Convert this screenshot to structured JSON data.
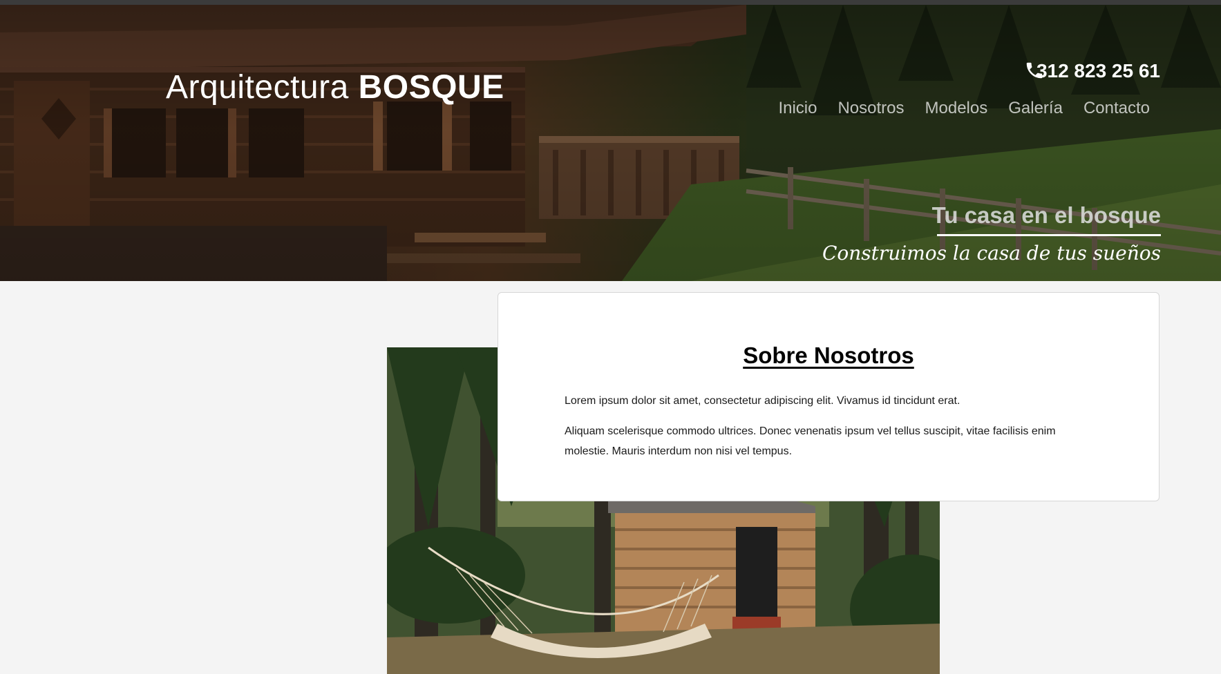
{
  "brand": {
    "name_light": "Arquitectura",
    "name_bold": "BOSQUE"
  },
  "header": {
    "phone": "312 823 25 61",
    "phone_icon": "phone-icon"
  },
  "nav": {
    "items": [
      {
        "label": "Inicio"
      },
      {
        "label": "Nosotros"
      },
      {
        "label": "Modelos"
      },
      {
        "label": "Galería"
      },
      {
        "label": "Contacto"
      }
    ]
  },
  "hero": {
    "title": "Tu casa en el bosque",
    "subtitle": "Construimos la casa de tus sueños"
  },
  "about": {
    "title": "Sobre Nosotros",
    "paragraphs": [
      "Lorem ipsum dolor sit amet, consectetur adipiscing elit. Vivamus id tincidunt erat.",
      "Aliquam scelerisque commodo ultrices. Donec venenatis ipsum vel tellus suscipit, vitae facilisis enim molestie. Mauris interdum non nisi vel tempus."
    ]
  },
  "colors": {
    "page_background": "#f4f4f4",
    "card_background": "#ffffff",
    "text_dark": "#000000"
  }
}
